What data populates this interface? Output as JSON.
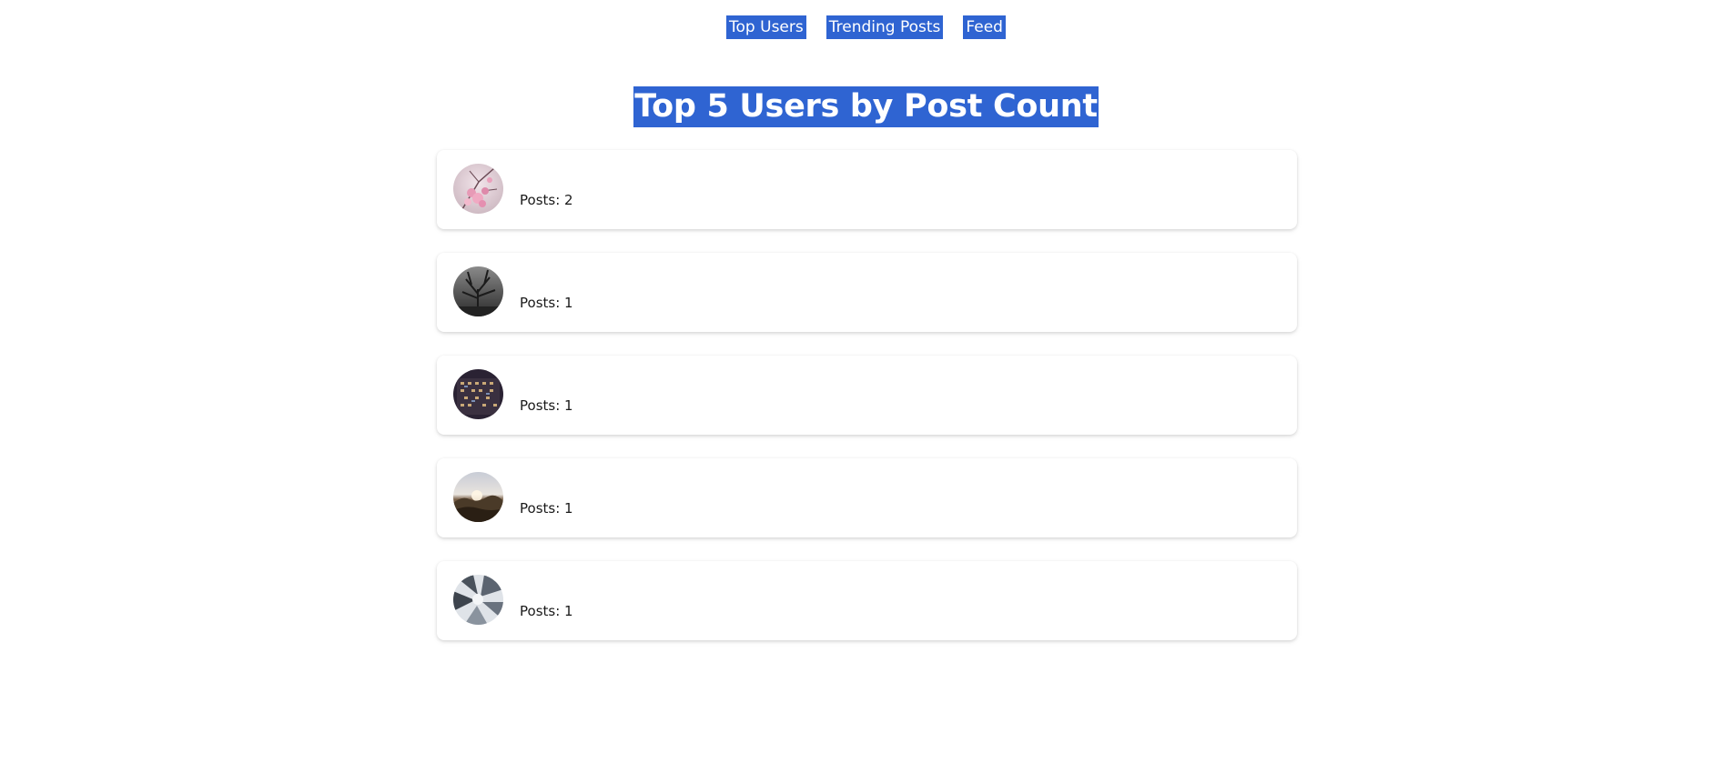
{
  "nav": {
    "items": [
      {
        "label": "Top Users"
      },
      {
        "label": "Trending Posts"
      },
      {
        "label": "Feed"
      }
    ]
  },
  "page": {
    "title": "Top 5 Users by Post Count"
  },
  "users": [
    {
      "posts_text": "Posts: 2",
      "avatar": "pink-blossom-photo"
    },
    {
      "posts_text": "Posts: 1",
      "avatar": "grayscale-tree-photo"
    },
    {
      "posts_text": "Posts: 1",
      "avatar": "city-building-night-photo"
    },
    {
      "posts_text": "Posts: 1",
      "avatar": "sunset-landscape-photo"
    },
    {
      "posts_text": "Posts: 1",
      "avatar": "abstract-gray-photo"
    }
  ],
  "colors": {
    "accent": "#2f64d2",
    "text": "#1a1a1a",
    "background": "#ffffff"
  }
}
